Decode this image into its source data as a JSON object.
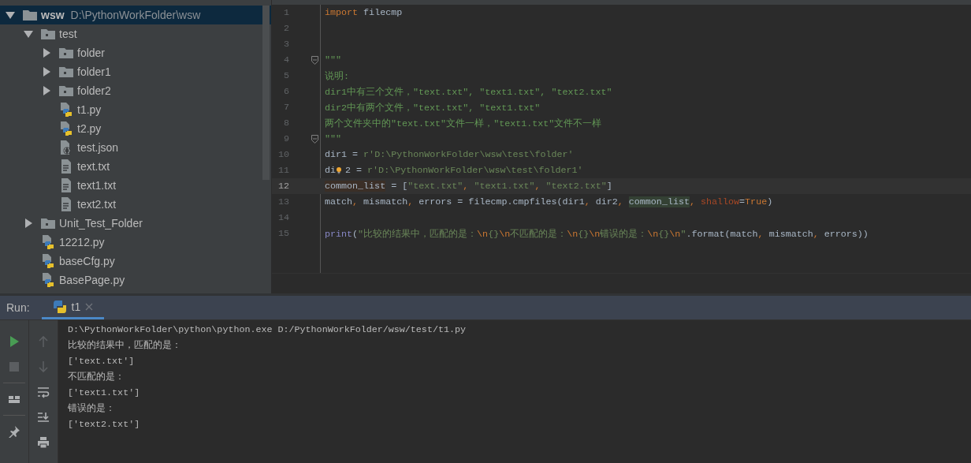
{
  "project_tree": {
    "items": [
      {
        "name": "wsw",
        "path": "D:\\PythonWorkFolder\\wsw",
        "kind": "root",
        "expanded": true,
        "selected": true,
        "children": [
          {
            "name": "test",
            "kind": "folder",
            "expanded": true,
            "selected": false,
            "children": [
              {
                "name": "folder",
                "kind": "folder",
                "expanded": false,
                "selected": false
              },
              {
                "name": "folder1",
                "kind": "folder",
                "expanded": false,
                "selected": false
              },
              {
                "name": "folder2",
                "kind": "folder",
                "expanded": false,
                "selected": false
              },
              {
                "name": "t1.py",
                "kind": "python",
                "selected": false
              },
              {
                "name": "t2.py",
                "kind": "python",
                "selected": false
              },
              {
                "name": "test.json",
                "kind": "json",
                "selected": false
              },
              {
                "name": "text.txt",
                "kind": "text",
                "selected": false
              },
              {
                "name": "text1.txt",
                "kind": "text",
                "selected": false
              },
              {
                "name": "text2.txt",
                "kind": "text",
                "selected": false
              }
            ]
          },
          {
            "name": "Unit_Test_Folder",
            "kind": "folder",
            "expanded": false,
            "selected": false
          },
          {
            "name": "12212.py",
            "kind": "python",
            "selected": false
          },
          {
            "name": "baseCfg.py",
            "kind": "python",
            "selected": false
          },
          {
            "name": "BasePage.py",
            "kind": "python",
            "selected": false
          }
        ]
      }
    ]
  },
  "editor": {
    "lines": [
      {
        "number": "1",
        "current": false,
        "fold": false,
        "tokens": [
          {
            "t": "import",
            "kind": "kw"
          },
          {
            "t": " filecmp",
            "kind": "plain"
          }
        ]
      },
      {
        "number": "2",
        "current": false,
        "fold": false
      },
      {
        "number": "3",
        "current": false,
        "fold": false
      },
      {
        "number": "4",
        "current": false,
        "fold": true,
        "tokens": [
          {
            "t": "\"\"\"",
            "kind": "doc"
          }
        ]
      },
      {
        "number": "5",
        "current": false,
        "fold": false,
        "tokens": [
          {
            "t": "说明:",
            "kind": "doc"
          }
        ]
      },
      {
        "number": "6",
        "current": false,
        "fold": false,
        "tokens": [
          {
            "t": "dir1中有三个文件，\"text.txt\", \"text1.txt\", \"text2.txt\"",
            "kind": "doc"
          }
        ]
      },
      {
        "number": "7",
        "current": false,
        "fold": false,
        "tokens": [
          {
            "t": "dir2中有两个文件，\"text.txt\", \"text1.txt\"",
            "kind": "doc"
          }
        ]
      },
      {
        "number": "8",
        "current": false,
        "fold": false,
        "tokens": [
          {
            "t": "两个文件夹中的\"text.txt\"文件一样，\"text1.txt\"文件不一样",
            "kind": "doc"
          }
        ]
      },
      {
        "number": "9",
        "current": false,
        "fold": true,
        "tokens": [
          {
            "t": "\"\"\"",
            "kind": "doc"
          }
        ]
      },
      {
        "number": "10",
        "current": false,
        "fold": false,
        "tokens": [
          {
            "t": "dir1 = ",
            "kind": "plain"
          },
          {
            "t": "r'D:\\PythonWorkFolder\\wsw\\test\\folder'",
            "kind": "str"
          }
        ]
      },
      {
        "number": "11",
        "current": false,
        "fold": false,
        "tokens": [
          {
            "t": "di",
            "kind": "plain"
          },
          {
            "kind": "bulb"
          },
          {
            "t": "2 = ",
            "kind": "plain"
          },
          {
            "t": "r'D:\\PythonWorkFolder\\wsw\\test\\folder1'",
            "kind": "str"
          }
        ]
      },
      {
        "number": "12",
        "current": true,
        "fold": false,
        "tokens": [
          {
            "t": "common_list",
            "kind": "def"
          },
          {
            "t": " = [",
            "kind": "plain"
          },
          {
            "t": "\"text.txt\"",
            "kind": "str"
          },
          {
            "t": ", ",
            "kind": "kw"
          },
          {
            "t": "\"text1.txt\"",
            "kind": "str"
          },
          {
            "t": ", ",
            "kind": "kw"
          },
          {
            "t": "\"text2.txt\"",
            "kind": "str"
          },
          {
            "t": "]",
            "kind": "plain"
          }
        ]
      },
      {
        "number": "13",
        "current": false,
        "fold": false,
        "tokens": [
          {
            "t": "match",
            "kind": "plain"
          },
          {
            "t": ", ",
            "kind": "kw"
          },
          {
            "t": "mismatch",
            "kind": "plain"
          },
          {
            "t": ", ",
            "kind": "kw"
          },
          {
            "t": "errors = filecmp.cmpfiles(dir1",
            "kind": "plain"
          },
          {
            "t": ", ",
            "kind": "kw"
          },
          {
            "t": "dir2",
            "kind": "plain"
          },
          {
            "t": ", ",
            "kind": "kw"
          },
          {
            "t": "common_list",
            "kind": "use"
          },
          {
            "t": ", ",
            "kind": "kw"
          },
          {
            "t": "shallow",
            "kind": "param"
          },
          {
            "t": "=",
            "kind": "plain"
          },
          {
            "t": "True",
            "kind": "kw"
          },
          {
            "t": ")",
            "kind": "plain"
          }
        ]
      },
      {
        "number": "14",
        "current": false,
        "fold": false
      },
      {
        "number": "15",
        "current": false,
        "fold": false,
        "tokens": [
          {
            "t": "print",
            "kind": "builtin"
          },
          {
            "t": "(",
            "kind": "plain"
          },
          {
            "t": "\"比较的结果中，匹配的是：",
            "kind": "str"
          },
          {
            "t": "\\n",
            "kind": "esc"
          },
          {
            "t": "{}",
            "kind": "str"
          },
          {
            "t": "\\n",
            "kind": "esc"
          },
          {
            "t": "不匹配的是：",
            "kind": "str"
          },
          {
            "t": "\\n",
            "kind": "esc"
          },
          {
            "t": "{}",
            "kind": "str"
          },
          {
            "t": "\\n",
            "kind": "esc"
          },
          {
            "t": "错误的是：",
            "kind": "str"
          },
          {
            "t": "\\n",
            "kind": "esc"
          },
          {
            "t": "{}",
            "kind": "str"
          },
          {
            "t": "\\n",
            "kind": "esc"
          },
          {
            "t": "\"",
            "kind": "str"
          },
          {
            "t": ".format(match",
            "kind": "plain"
          },
          {
            "t": ", ",
            "kind": "kw"
          },
          {
            "t": "mismatch",
            "kind": "plain"
          },
          {
            "t": ", ",
            "kind": "kw"
          },
          {
            "t": "errors))",
            "kind": "plain"
          }
        ]
      }
    ]
  },
  "run_panel": {
    "label": "Run:",
    "tabs": [
      {
        "label": "t1",
        "selected": true
      }
    ],
    "toolbar_left": [
      {
        "kind": "run",
        "disabled": false
      },
      {
        "kind": "stop",
        "disabled": true
      },
      {
        "kind": "layout",
        "disabled": false
      },
      {
        "kind": "pin",
        "disabled": false
      }
    ],
    "toolbar_right": [
      {
        "kind": "up",
        "disabled": true
      },
      {
        "kind": "down",
        "disabled": true
      },
      {
        "kind": "wrap",
        "disabled": false
      },
      {
        "kind": "scroll-end",
        "disabled": false
      },
      {
        "kind": "print",
        "disabled": false
      }
    ],
    "console": [
      "D:\\PythonWorkFolder\\python\\python.exe D:/PythonWorkFolder/wsw/test/t1.py",
      "比较的结果中，匹配的是：",
      "['text.txt']",
      "不匹配的是：",
      "['text1.txt']",
      "错误的是：",
      "['text2.txt']"
    ]
  }
}
